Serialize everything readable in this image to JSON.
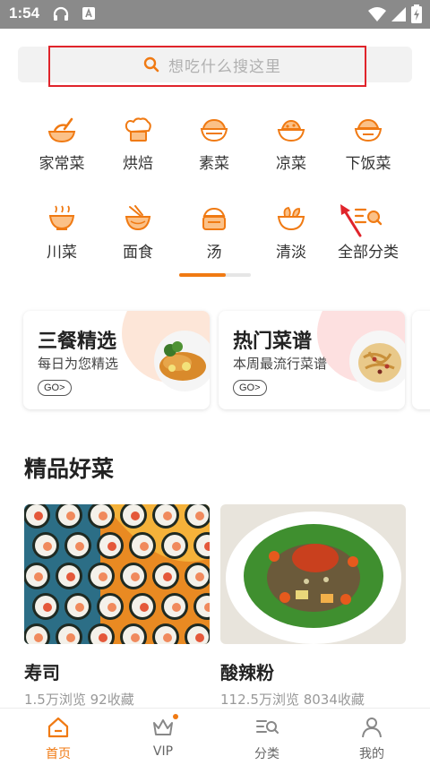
{
  "status_bar": {
    "time": "1:54"
  },
  "search": {
    "placeholder": "想吃什么搜这里"
  },
  "categories": [
    {
      "label": "家常菜",
      "icon": "home-dish-icon"
    },
    {
      "label": "烘焙",
      "icon": "chef-hat-icon"
    },
    {
      "label": "素菜",
      "icon": "veggie-bowl-icon"
    },
    {
      "label": "凉菜",
      "icon": "cold-dish-icon"
    },
    {
      "label": "下饭菜",
      "icon": "rice-bowl-icon"
    },
    {
      "label": "川菜",
      "icon": "hotpot-icon"
    },
    {
      "label": "面食",
      "icon": "noodles-icon"
    },
    {
      "label": "汤",
      "icon": "soup-pot-icon"
    },
    {
      "label": "清淡",
      "icon": "salad-bowl-icon"
    },
    {
      "label": "全部分类",
      "icon": "all-categories-icon"
    }
  ],
  "pager": {
    "active_fraction": 0.65
  },
  "features": [
    {
      "title": "三餐精选",
      "subtitle": "每日为您精选",
      "go": "GO>",
      "blob_color": "#fde6d8"
    },
    {
      "title": "热门菜谱",
      "subtitle": "本周最流行菜谱",
      "go": "GO>",
      "blob_color": "#fde0e0"
    }
  ],
  "section": {
    "title": "精品好菜"
  },
  "dishes": [
    {
      "name": "寿司",
      "meta": "1.5万浏览 92收藏"
    },
    {
      "name": "酸辣粉",
      "meta": "112.5万浏览 8034收藏"
    }
  ],
  "nav": {
    "tabs": [
      {
        "label": "首页",
        "icon": "home-icon",
        "active": true
      },
      {
        "label": "VIP",
        "icon": "crown-icon",
        "active": false
      },
      {
        "label": "分类",
        "icon": "category-search-icon",
        "active": false
      },
      {
        "label": "我的",
        "icon": "profile-icon",
        "active": false
      }
    ]
  },
  "colors": {
    "accent": "#f07a13",
    "highlight": "#e0242b"
  }
}
